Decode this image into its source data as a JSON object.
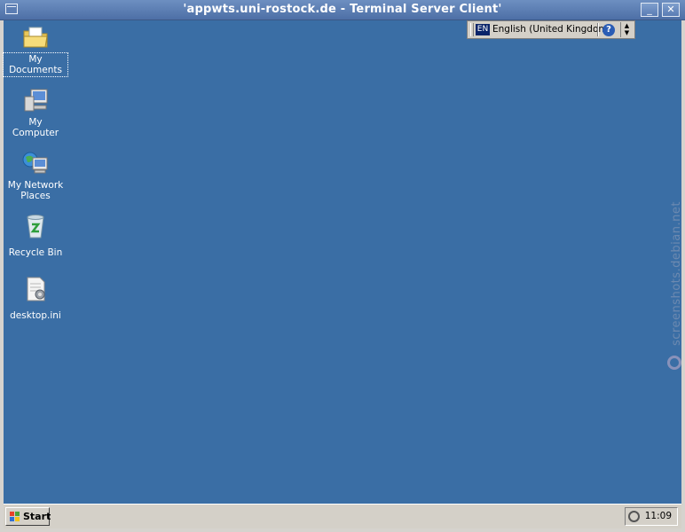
{
  "window": {
    "title": "'appwts.uni-rostock.de - Terminal Server Client'",
    "minimize_glyph": "_",
    "close_glyph": "✕"
  },
  "desktop": {
    "icons": [
      {
        "label": "My Documents",
        "icon": "my-documents-folder-icon",
        "selected": true
      },
      {
        "label": "My Computer",
        "icon": "my-computer-icon"
      },
      {
        "label": "My Network Places",
        "icon": "network-places-icon"
      },
      {
        "label": "Recycle Bin",
        "icon": "recycle-bin-icon"
      },
      {
        "label": "desktop.ini",
        "icon": "ini-file-icon"
      }
    ]
  },
  "language_bar": {
    "code": "EN",
    "language": "English (United Kingdom)",
    "help_glyph": "?"
  },
  "taskbar": {
    "start_label": "Start",
    "clock": "11:09"
  },
  "watermark": {
    "text": "screenshots.debian.net"
  },
  "colors": {
    "desktop": "#3a6ea5",
    "titlebar": "#5a7cb4",
    "taskbar": "#d4d0c8"
  }
}
